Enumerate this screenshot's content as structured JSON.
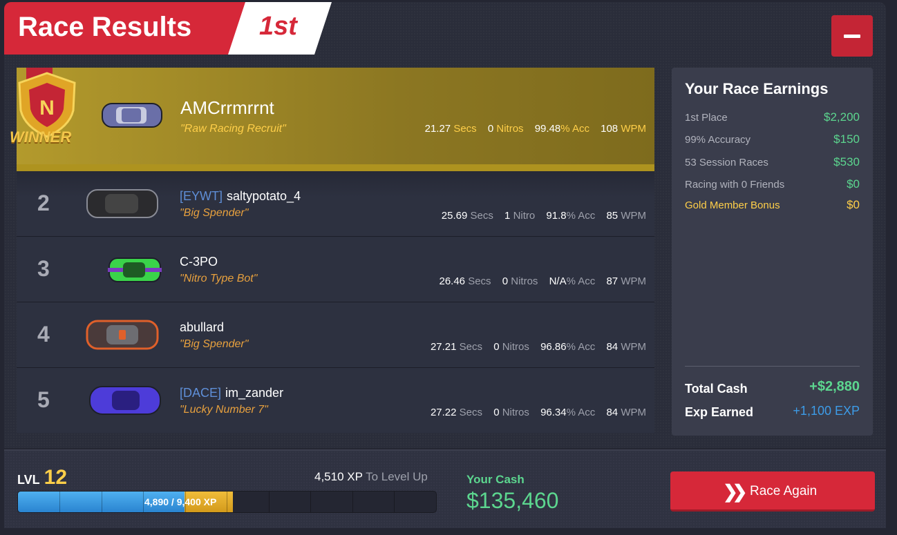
{
  "header": {
    "title": "Race Results",
    "place": "1st"
  },
  "winner_badge": {
    "text": "WINNER"
  },
  "racers": [
    {
      "position": "1",
      "tag": "",
      "name": "AMCrrmrrnt",
      "title": "\"Raw Racing Recruit\"",
      "secs": "21.27",
      "secs_unit": "Secs",
      "nitros": "0",
      "nitros_unit": "Nitros",
      "acc": "99.48",
      "acc_unit": "% Acc",
      "wpm": "108",
      "wpm_unit": "WPM",
      "car_color": "#6a6fa8"
    },
    {
      "position": "2",
      "tag": "[EYWT]",
      "name": "saltypotato_4",
      "title": "\"Big Spender\"",
      "secs": "25.69",
      "secs_unit": "Secs",
      "nitros": "1",
      "nitros_unit": "Nitro",
      "acc": "91.8",
      "acc_unit": "% Acc",
      "wpm": "85",
      "wpm_unit": "WPM",
      "car_color": "#2b2b2e"
    },
    {
      "position": "3",
      "tag": "",
      "name": "C-3PO",
      "title": "\"Nitro Type Bot\"",
      "secs": "26.46",
      "secs_unit": "Secs",
      "nitros": "0",
      "nitros_unit": "Nitros",
      "acc": "N/A",
      "acc_unit": "% Acc",
      "wpm": "87",
      "wpm_unit": "WPM",
      "car_color": "#3ad34a"
    },
    {
      "position": "4",
      "tag": "",
      "name": "abullard",
      "title": "\"Big Spender\"",
      "secs": "27.21",
      "secs_unit": "Secs",
      "nitros": "0",
      "nitros_unit": "Nitros",
      "acc": "96.86",
      "acc_unit": "% Acc",
      "wpm": "84",
      "wpm_unit": "WPM",
      "car_color": "#4a3a3a"
    },
    {
      "position": "5",
      "tag": "[DACE]",
      "name": "im_zander",
      "title": "\"Lucky Number 7\"",
      "secs": "27.22",
      "secs_unit": "Secs",
      "nitros": "0",
      "nitros_unit": "Nitros",
      "acc": "96.34",
      "acc_unit": "% Acc",
      "wpm": "84",
      "wpm_unit": "WPM",
      "car_color": "#4d3cd9"
    }
  ],
  "earnings": {
    "title": "Your Race Earnings",
    "items": [
      {
        "label": "1st Place",
        "value": "$2,200"
      },
      {
        "label": "99% Accuracy",
        "value": "$150"
      },
      {
        "label": "53 Session Races",
        "value": "$530"
      },
      {
        "label": "Racing with 0 Friends",
        "value": "$0"
      },
      {
        "label": "Gold Member Bonus",
        "value": "$0"
      }
    ],
    "total_cash_label": "Total Cash",
    "total_cash_value": "+$2,880",
    "exp_label": "Exp Earned",
    "exp_value": "+1,100 EXP"
  },
  "footer": {
    "lvl_label": "LVL",
    "lvl_value": "12",
    "to_level_value": "4,510 XP",
    "to_level_label": "To Level Up",
    "xp_text": "4,890 / 9,400 XP",
    "xp_prev_fraction": 0.3984,
    "xp_total_fraction": 0.5135,
    "cash_label": "Your Cash",
    "cash_value": "$135,460",
    "race_again_label": "Race Again"
  },
  "colors": {
    "accent_red": "#d62839",
    "gold": "#ffcf49",
    "cash_green": "#5cd68f",
    "exp_blue": "#3d9ce8"
  }
}
